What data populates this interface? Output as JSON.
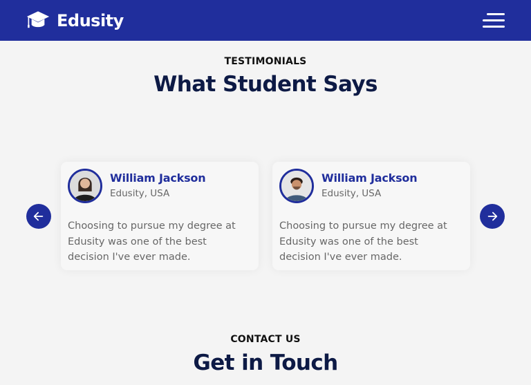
{
  "nav": {
    "brand": "Edusity",
    "logo_icon": "graduation-cap-icon",
    "menu_icon": "hamburger-menu-icon"
  },
  "testimonials": {
    "subtitle": "TESTIMONIALS",
    "title": "What Student Says",
    "prev_icon": "arrow-left-icon",
    "next_icon": "arrow-right-icon",
    "cards": [
      {
        "name": "William Jackson",
        "location": "Edusity, USA",
        "quote": "Choosing to pursue my degree at Edusity was one of the best decision I've ever made.",
        "avatar_icon": "user-photo"
      },
      {
        "name": "William Jackson",
        "location": "Edusity, USA",
        "quote": "Choosing to pursue my degree at Edusity was one of the best decision I've ever made.",
        "avatar_icon": "user-photo"
      }
    ]
  },
  "contact": {
    "subtitle": "CONTACT US",
    "title": "Get in Touch"
  },
  "colors": {
    "primary": "#202e9c",
    "heading": "#0d1a45",
    "background": "#f4f4f4",
    "muted_text": "#676767"
  }
}
